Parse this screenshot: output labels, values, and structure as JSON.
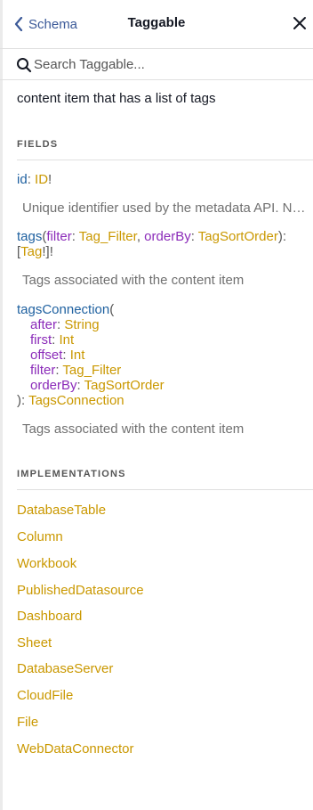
{
  "header": {
    "back_label": "Schema",
    "title": "Taggable"
  },
  "search": {
    "placeholder": "Search Taggable..."
  },
  "description": "content item that has a list of tags",
  "fields_section": {
    "title": "FIELDS",
    "fields": {
      "id": {
        "name": "id",
        "type": "ID",
        "bang": "!",
        "description": "Unique identifier used by the metadata API. N…"
      },
      "tags": {
        "name": "tags",
        "args": {
          "filter": {
            "name": "filter",
            "type": "Tag_Filter"
          },
          "orderBy": {
            "name": "orderBy",
            "type": "TagSortOrder"
          }
        },
        "return_type": "Tag",
        "description": "Tags associated with the content item"
      },
      "tagsConnection": {
        "name": "tagsConnection",
        "args": {
          "after": {
            "name": "after",
            "type": "String"
          },
          "first": {
            "name": "first",
            "type": "Int"
          },
          "offset": {
            "name": "offset",
            "type": "Int"
          },
          "filter": {
            "name": "filter",
            "type": "Tag_Filter"
          },
          "orderBy": {
            "name": "orderBy",
            "type": "TagSortOrder"
          }
        },
        "return_type": "TagsConnection",
        "description": "Tags associated with the content item"
      }
    }
  },
  "implementations_section": {
    "title": "IMPLEMENTATIONS",
    "items": [
      "DatabaseTable",
      "Column",
      "Workbook",
      "PublishedDatasource",
      "Dashboard",
      "Sheet",
      "DatabaseServer",
      "CloudFile",
      "File",
      "WebDataConnector"
    ]
  },
  "colors": {
    "link_blue": "#3b5998",
    "field_name": "#1f61a0",
    "arg_name": "#8b2bb9",
    "type_name": "#ca9800",
    "muted_text": "#707070"
  },
  "icons": {
    "back": "chevron-left-icon",
    "close": "close-icon",
    "search": "search-icon"
  }
}
